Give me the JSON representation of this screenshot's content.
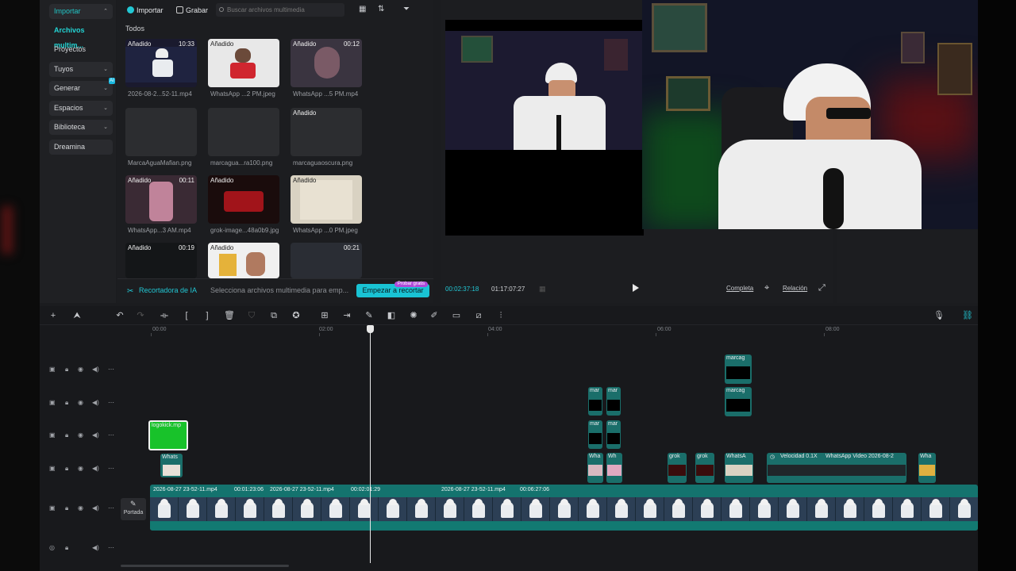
{
  "nav": {
    "items": [
      {
        "label": "Importar",
        "chev": "⌃"
      },
      {
        "label": "Archivos multim..."
      },
      {
        "label": "Proyectos secun..."
      },
      {
        "label": "Tuyos",
        "chev": "⌄"
      },
      {
        "label": "Generar",
        "chev": "⌄",
        "badge": "AI"
      },
      {
        "label": "Espacios",
        "chev": "⌄"
      },
      {
        "label": "Biblioteca",
        "chev": "⌄"
      },
      {
        "label": "Dreamina"
      }
    ]
  },
  "media": {
    "import_label": "Importar",
    "record_label": "Grabar",
    "search_placeholder": "Buscar archivos multimedia",
    "filter_all": "Todos",
    "tiles": [
      {
        "tag": "Añadido",
        "duration": "10:33",
        "name": "2026-08-2...52-11.mp4"
      },
      {
        "tag": "Añadido",
        "duration": "",
        "name": "WhatsApp ...2 PM.jpeg"
      },
      {
        "tag": "Añadido",
        "duration": "00:12",
        "name": "WhatsApp ...5 PM.mp4"
      },
      {
        "tag": "",
        "duration": "",
        "name": "MarcaAguaMafian.png"
      },
      {
        "tag": "",
        "duration": "",
        "name": "marcagua...ra100.png"
      },
      {
        "tag": "Añadido",
        "duration": "",
        "name": "marcaguaoscura.png"
      },
      {
        "tag": "Añadido",
        "duration": "00:11",
        "name": "WhatsApp...3 AM.mp4"
      },
      {
        "tag": "Añadido",
        "duration": "",
        "name": "grok-image...48a0b9.jpg"
      },
      {
        "tag": "Añadido",
        "duration": "",
        "name": "WhatsApp ...0 PM.jpeg"
      },
      {
        "tag": "Añadido",
        "duration": "00:19",
        "name": ""
      },
      {
        "tag": "Añadido",
        "duration": "",
        "name": ""
      },
      {
        "tag": "",
        "duration": "00:21",
        "name": ""
      }
    ],
    "ai_label": "Recortadora de IA",
    "ai_desc": "Selecciona archivos multimedia para emp...",
    "ai_button": "Empezar a recortar",
    "ai_pill": "Probar gratis"
  },
  "player": {
    "current_time": "00:02:37:18",
    "total_time": "01:17:07:27",
    "full_label": "Completa",
    "ratio_label": "Relación"
  },
  "timeline": {
    "ruler": [
      "00:00",
      "02:00",
      "04:00",
      "06:00",
      "08:00"
    ],
    "portada_label": "Portada",
    "clips": {
      "logo": "logokick.mp",
      "whats_small": "Whats",
      "mar1": "mar",
      "mar2": "mar",
      "mar3": "mar",
      "mar4": "mar",
      "marcag1": "marcag",
      "marcag2": "marcag",
      "wha1": "Wha",
      "wh2": "Wh",
      "grok1": "grok",
      "grok2": "grok",
      "whatsa": "WhatsA",
      "speed": "Velocidad 0.1X",
      "whats_video": "WhatsApp Video 2026-08-2",
      "wha_end": "Wha"
    },
    "main_segments": [
      {
        "name": "2026-08-27 23-52-11.mp4",
        "time": "00:01:23:06"
      },
      {
        "name": "2026-08-27 23-52-11.mp4",
        "time": "00:02:01:29"
      },
      {
        "name": "2026-08-27 23-52-11.mp4",
        "time": "00:06:27:06"
      }
    ]
  },
  "colors": {
    "accent": "#22c7d4",
    "track": "#14736e",
    "ai_pill": "#b04ad8"
  }
}
